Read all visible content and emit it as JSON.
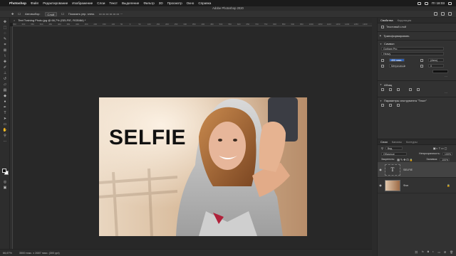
{
  "menubar": {
    "app_name": "Photoshop",
    "items": [
      "Файл",
      "Редактирование",
      "Изображение",
      "Слои",
      "Текст",
      "Выделение",
      "Фильтр",
      "3D",
      "Просмотр",
      "Окно",
      "Справка"
    ],
    "clock": "Пт 18:03"
  },
  "window": {
    "title": "Adobe Photoshop 2020"
  },
  "options_bar": {
    "auto_select_label": "Автовыбор:",
    "auto_select_value": "Слой",
    "show_controls_label": "Показать упр. элем."
  },
  "document": {
    "tab_title": "Text Training Photo.jpg @ 66,7% (SELFIE, RGB/8#) *",
    "ruler_ticks": [
      "650",
      "600",
      "550",
      "500",
      "450",
      "400",
      "350",
      "300",
      "250",
      "200",
      "150",
      "100",
      "50",
      "0",
      "50",
      "100",
      "150",
      "200",
      "250",
      "300",
      "350",
      "400",
      "450",
      "500",
      "550",
      "600",
      "650",
      "700",
      "750",
      "800",
      "850",
      "900",
      "950",
      "1000",
      "1050",
      "1100",
      "1150",
      "1200",
      "1250",
      "1300",
      "1350",
      "1400",
      "1450",
      "1500",
      "1550",
      "1600",
      "1650",
      "1700",
      "1750",
      "1800",
      "1850",
      "1900",
      "1950",
      "2000",
      "2050",
      "2100",
      "2150",
      "2200",
      "2250",
      "2300",
      "2350",
      "2400",
      "2450",
      "2500",
      "2550",
      "2600",
      "2650",
      "2700",
      "2750",
      "2800",
      "2850",
      "2900",
      "2950",
      "3000",
      "3050",
      "3100",
      "3150"
    ],
    "overlay_text": "SELFIE",
    "status_zoom": "66,67%",
    "status_info": "3500 пикс. x 2687 пикс. (300 ppi)"
  },
  "properties": {
    "tabs": [
      "Свойства",
      "Коррекция"
    ],
    "layer_kind": "Текстовый слой",
    "section_transform": "Трансформировать",
    "section_symbol": "Символ",
    "font_family": "Gotham Pro",
    "font_style": "Heavy",
    "font_size": "400 пикс.",
    "leading": "(Авто)",
    "tracking": "Метрически",
    "kerning": "0",
    "section_paragraph": "Абзац",
    "section_text_tool": "Параметры инструмента \"Текст\""
  },
  "layers_panel": {
    "tabs": [
      "Слои",
      "Каналы",
      "Контуры"
    ],
    "filter_label": "Вид",
    "blend_mode": "Обычные",
    "opacity_label": "Непрозрачность:",
    "opacity_value": "100%",
    "lock_label": "Закрепить:",
    "fill_label": "Заливка:",
    "fill_value": "100%",
    "layers": [
      {
        "name": "SELFIE",
        "kind": "text",
        "selected": true
      },
      {
        "name": "Фон",
        "kind": "image",
        "selected": false
      }
    ]
  },
  "colors": {
    "accent": "#2e5fb3",
    "app_bg": "#282828",
    "panel_bg": "#323232"
  }
}
